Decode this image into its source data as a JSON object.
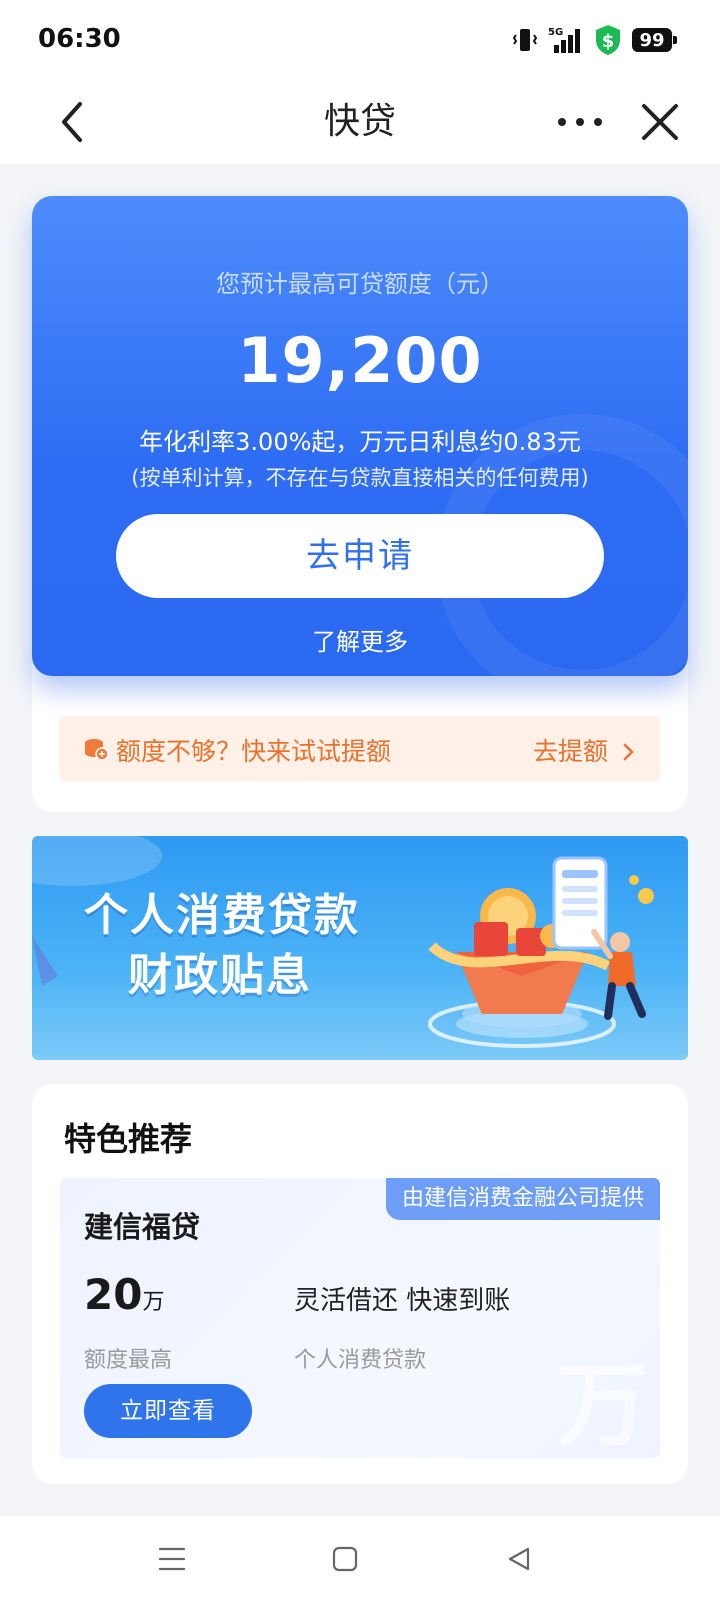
{
  "status": {
    "time": "06:30",
    "network": "5G",
    "battery": "99"
  },
  "nav": {
    "title": "快贷"
  },
  "hero": {
    "label": "您预计最高可贷额度（元）",
    "amount": "19,200",
    "rate": "年化利率3.00%起，万元日利息约0.83元",
    "note": "(按单利计算，不存在与贷款直接相关的任何费用)",
    "apply_label": "去申请",
    "learn_more": "了解更多"
  },
  "quota": {
    "text": "额度不够？快来试试提额",
    "link": "去提额"
  },
  "banner": {
    "line1": "个人消费贷款",
    "line2": "财政贴息"
  },
  "recommend": {
    "title": "特色推荐",
    "product": {
      "provider": "由建信消费金融公司提供",
      "name": "建信福贷",
      "limit_value": "20",
      "limit_unit": "万",
      "limit_label": "额度最高",
      "feature": "灵活借还 快速到账",
      "feature_sub": "个人消费贷款",
      "button": "立即查看"
    }
  },
  "colors": {
    "primary": "#2f6ff0",
    "orange": "#e9712c",
    "quota_bg": "#fff1e8"
  }
}
